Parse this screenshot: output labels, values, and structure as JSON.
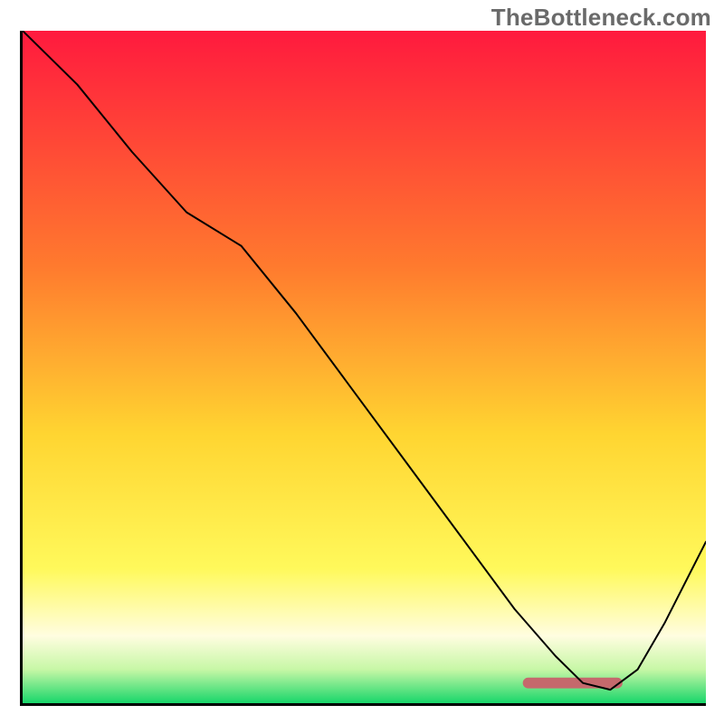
{
  "watermark": "TheBottleneck.com",
  "chart_data": {
    "type": "line",
    "title": "",
    "xlabel": "",
    "ylabel": "",
    "xlim": [
      0,
      100
    ],
    "ylim": [
      0,
      100
    ],
    "grid": false,
    "legend": false,
    "background_gradient_stops": [
      {
        "offset": 0.0,
        "color": "#ff1a3e"
      },
      {
        "offset": 0.35,
        "color": "#ff7a2e"
      },
      {
        "offset": 0.6,
        "color": "#ffd531"
      },
      {
        "offset": 0.8,
        "color": "#fff95b"
      },
      {
        "offset": 0.9,
        "color": "#fffde0"
      },
      {
        "offset": 0.95,
        "color": "#c7f7a6"
      },
      {
        "offset": 1.0,
        "color": "#18d66a"
      }
    ],
    "marker_band": {
      "color": "#c5696c",
      "x_start": 74,
      "x_end": 87,
      "y": 3.0,
      "thickness": 1.6
    },
    "series": [
      {
        "name": "curve",
        "stroke": "#000000",
        "stroke_width": 2,
        "x": [
          0,
          8,
          16,
          24,
          32,
          40,
          48,
          56,
          64,
          72,
          78,
          82,
          86,
          90,
          94,
          100
        ],
        "y": [
          100,
          92,
          82,
          73,
          68,
          58,
          47,
          36,
          25,
          14,
          7,
          3,
          2,
          5,
          12,
          24
        ]
      }
    ]
  }
}
